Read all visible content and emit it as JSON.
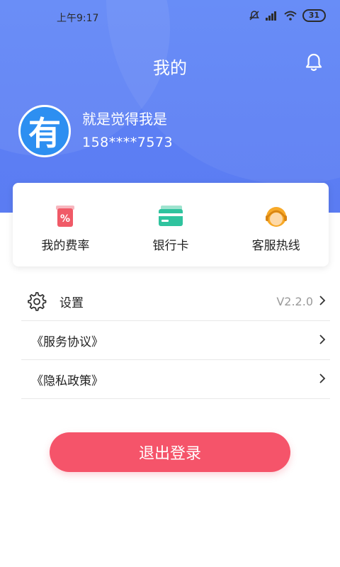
{
  "status": {
    "time": "上午9:17",
    "battery": "31"
  },
  "header": {
    "title": "我的"
  },
  "profile": {
    "avatar_char": "有",
    "username": "就是觉得我是",
    "phone": "158****7573"
  },
  "quick_actions": [
    {
      "label": "我的费率",
      "icon": "rate-icon"
    },
    {
      "label": "银行卡",
      "icon": "bank-card-icon"
    },
    {
      "label": "客服热线",
      "icon": "customer-service-icon"
    }
  ],
  "menu": {
    "settings_label": "设置",
    "version": "V2.2.0",
    "service_agreement": "《服务协议》",
    "privacy_policy": "《隐私政策》"
  },
  "logout": {
    "label": "退出登录"
  },
  "colors": {
    "header_blue": "#5c7ff4",
    "logout_red": "#f5546a",
    "avatar_blue": "#2d8ff1"
  }
}
